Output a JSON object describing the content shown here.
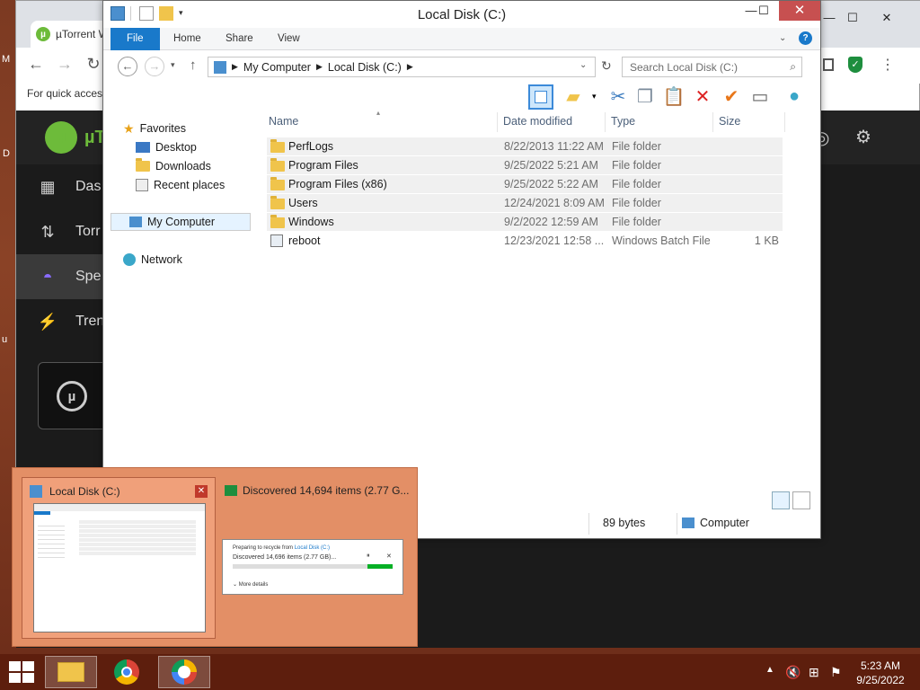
{
  "desktop": {
    "edge_chars": [
      "M",
      "D",
      "u"
    ]
  },
  "chrome": {
    "tab_title": "µTorrent W",
    "bookmarks_text": "For quick access",
    "shield_color": "#1e8e3e"
  },
  "utorrent": {
    "brand": "µT",
    "sidebar": [
      {
        "label": "Das",
        "icon": "dashboard-icon"
      },
      {
        "label": "Torr",
        "icon": "torrents-icon"
      },
      {
        "label": "Spe",
        "icon": "speed-icon"
      },
      {
        "label": "Tren",
        "icon": "trends-icon"
      }
    ]
  },
  "explorer": {
    "title": "Local Disk (C:)",
    "ribbon_tabs": [
      "File",
      "Home",
      "Share",
      "View"
    ],
    "breadcrumb": [
      "My Computer",
      "Local Disk (C:)"
    ],
    "search_placeholder": "Search Local Disk (C:)",
    "nav": {
      "favorites": "Favorites",
      "desktop": "Desktop",
      "downloads": "Downloads",
      "recent": "Recent places",
      "computer": "My Computer",
      "network": "Network"
    },
    "columns": {
      "name": "Name",
      "date": "Date modified",
      "type": "Type",
      "size": "Size"
    },
    "files": [
      {
        "name": "PerfLogs",
        "date": "8/22/2013 11:22 AM",
        "type": "File folder",
        "size": "",
        "kind": "folder"
      },
      {
        "name": "Program Files",
        "date": "9/25/2022 5:21 AM",
        "type": "File folder",
        "size": "",
        "kind": "folder"
      },
      {
        "name": "Program Files (x86)",
        "date": "9/25/2022 5:22 AM",
        "type": "File folder",
        "size": "",
        "kind": "folder"
      },
      {
        "name": "Users",
        "date": "12/24/2021 8:09 AM",
        "type": "File folder",
        "size": "",
        "kind": "folder"
      },
      {
        "name": "Windows",
        "date": "9/2/2022 12:59 AM",
        "type": "File folder",
        "size": "",
        "kind": "folder"
      },
      {
        "name": "reboot",
        "date": "12/23/2021 12:58 ...",
        "type": "Windows Batch File",
        "size": "1 KB",
        "kind": "file"
      }
    ],
    "status_size": "89 bytes",
    "status_location": "Computer"
  },
  "thumbnails": {
    "explorer_title": "Local Disk (C:)",
    "copy_title": "Discovered 14,694 items (2.77 G...",
    "copy_dialog": {
      "heading_prefix": "Preparing to recycle from ",
      "heading_link": "Local Disk (C:)",
      "status": "Discovered 14,696 items (2.77 GB)...",
      "more": "More details",
      "progress_fraction": 0.16
    }
  },
  "taskbar": {
    "time": "5:23 AM",
    "date": "9/25/2022"
  }
}
